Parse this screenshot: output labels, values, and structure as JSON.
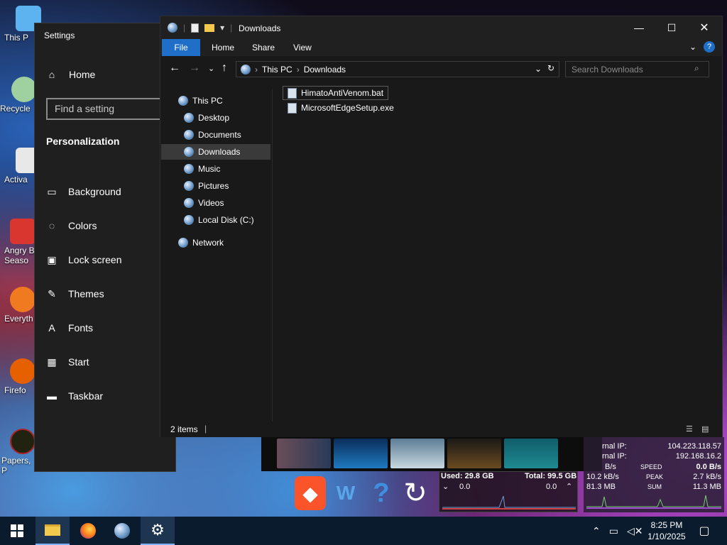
{
  "desktop": {
    "icons": [
      {
        "label": "This P",
        "name": "this-pc"
      },
      {
        "label": "Recycle",
        "name": "recycle-bin"
      },
      {
        "label": "Activa",
        "name": "activation"
      },
      {
        "label": "Angry B Seaso",
        "name": "angry-birds"
      },
      {
        "label": "Everyth",
        "name": "everything"
      },
      {
        "label": "Firefo",
        "name": "firefox"
      },
      {
        "label": "Papers, P",
        "name": "papers-please"
      }
    ]
  },
  "settings": {
    "title": "Settings",
    "home_label": "Home",
    "search_placeholder": "Find a setting",
    "section": "Personalization",
    "items": [
      {
        "label": "Background",
        "icon": "picture-icon"
      },
      {
        "label": "Colors",
        "icon": "palette-icon"
      },
      {
        "label": "Lock screen",
        "icon": "lock-screen-icon"
      },
      {
        "label": "Themes",
        "icon": "themes-icon"
      },
      {
        "label": "Fonts",
        "icon": "fonts-icon"
      },
      {
        "label": "Start",
        "icon": "start-icon"
      },
      {
        "label": "Taskbar",
        "icon": "taskbar-icon"
      }
    ]
  },
  "explorer": {
    "title": "Downloads",
    "ribbon_tabs": [
      "File",
      "Home",
      "Share",
      "View"
    ],
    "breadcrumb": [
      "This PC",
      "Downloads"
    ],
    "search_placeholder": "Search Downloads",
    "tree": [
      {
        "label": "This PC",
        "level": 0
      },
      {
        "label": "Desktop",
        "level": 1
      },
      {
        "label": "Documents",
        "level": 1
      },
      {
        "label": "Downloads",
        "level": 1,
        "selected": true
      },
      {
        "label": "Music",
        "level": 1
      },
      {
        "label": "Pictures",
        "level": 1
      },
      {
        "label": "Videos",
        "level": 1
      },
      {
        "label": "Local Disk (C:)",
        "level": 1
      },
      {
        "label": "Network",
        "level": 0
      }
    ],
    "files": [
      {
        "name": "HimatoAntiVenom.bat",
        "selected": true
      },
      {
        "name": "MicrosoftEdgeSetup.exe",
        "selected": false
      }
    ],
    "status": "2 items"
  },
  "disk_widget": {
    "used": "Used: 29.8 GB",
    "total": "Total: 99.5 GB",
    "read": "0.0",
    "write": "0.0"
  },
  "net_widget": {
    "external_ip_label": "rnal IP:",
    "external_ip": "104.223.118.57",
    "internal_ip_label": "rnal IP:",
    "internal_ip": "192.168.16.2",
    "speed_down": "B/s",
    "speed_label": "SPEED",
    "speed_up": "0.0 B/s",
    "peak_down": "10.2 kB/s",
    "peak_label": "PEAK",
    "peak_up": "2.7 kB/s",
    "sum_down": "81.3 MB",
    "sum_label": "SUM",
    "sum_up": "11.3 MB"
  },
  "taskbar": {
    "time": "8:25 PM",
    "date": "1/10/2025"
  }
}
